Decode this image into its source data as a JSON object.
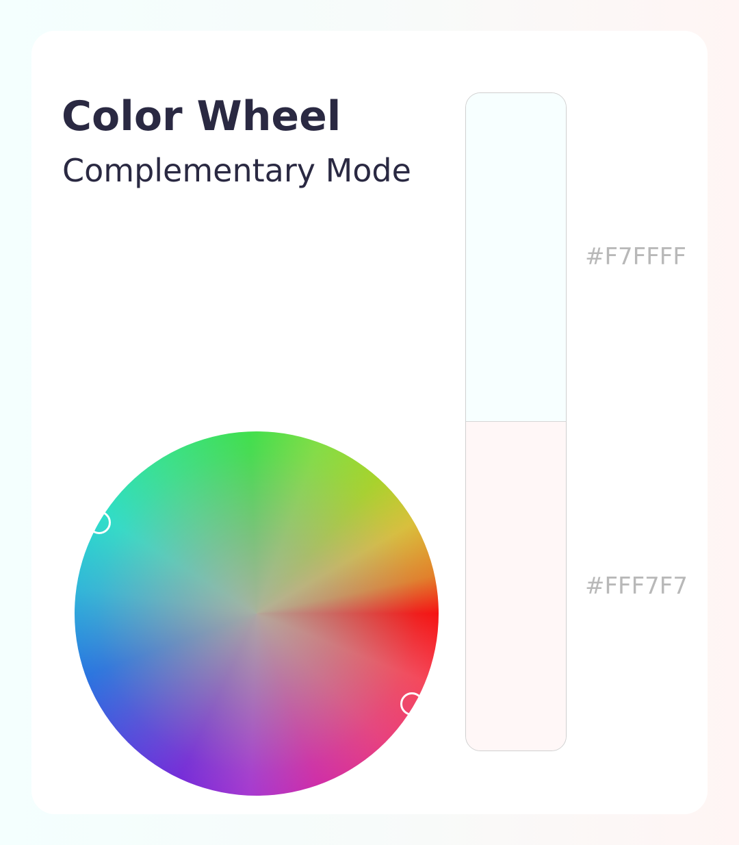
{
  "header": {
    "title": "Color Wheel",
    "subtitle": "Complementary Mode"
  },
  "wheel": {
    "handles": [
      {
        "name": "primary",
        "icon": "circle-handle"
      },
      {
        "name": "complement",
        "icon": "circle-handle"
      }
    ]
  },
  "swatches": [
    {
      "hex": "#F7FFFF",
      "color": "#F7FFFF"
    },
    {
      "hex": "#FFF7F7",
      "color": "#FFF7F7"
    }
  ],
  "colors": {
    "text_primary": "#2A2942",
    "hex_label": "#B8B8B8",
    "card_background": "#FFFFFF"
  }
}
